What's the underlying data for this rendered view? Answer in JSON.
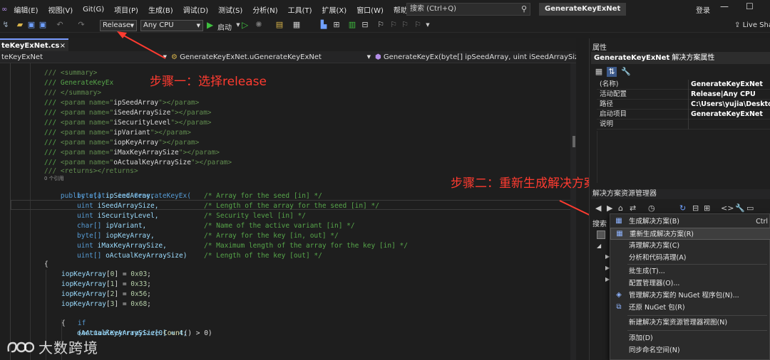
{
  "menubar": {
    "items": [
      "编辑(E)",
      "视图(V)",
      "Git(G)",
      "项目(P)",
      "生成(B)",
      "调试(D)",
      "测试(S)",
      "分析(N)",
      "工具(T)",
      "扩展(X)",
      "窗口(W)",
      "帮助(H)"
    ],
    "search_placeholder": "搜索 (Ctrl+Q)",
    "solution_name": "GenerateKeyExNet",
    "login": "登录"
  },
  "toolbar": {
    "configuration": "Release",
    "platform": "Any CPU",
    "start_label": "启动",
    "live_share": "Live Sha"
  },
  "doc_tab": {
    "label": "teKeyExNet.cs",
    "close": "×"
  },
  "navbar": {
    "project": "teKeyExNet",
    "class": "GenerateKeyExNet.uGenerateKeyExNet",
    "member": "GenerateKeyEx(byte[] ipSeedArray, uint iSeedArraySize"
  },
  "code": {
    "doc_summary_open": "/// <summary>",
    "doc_summary_text": "/// GenerateKeyEx",
    "doc_summary_close": "/// </summary>",
    "params": [
      "ipSeedArray",
      "iSeedArraySize",
      "iSecurityLevel",
      "ipVariant",
      "iopKeyArray",
      "iMaxKeyArraySize",
      "oActualKeyArraySize"
    ],
    "doc_returns": "/// <returns></returns>",
    "refs": "0 个引用",
    "signature": "public static int GenerateKeyEx(",
    "args": [
      {
        "type": "byte[]",
        "name": "ipSeedArray,",
        "comment": "/* Array for the seed [in] */"
      },
      {
        "type": "uint",
        "name": "iSeedArraySize,",
        "comment": "/* Length of the array for the seed [in] */"
      },
      {
        "type": "uint",
        "name": "iSecurityLevel,",
        "comment": "/* Security level [in] */"
      },
      {
        "type": "char[]",
        "name": "ipVariant,",
        "comment": "/* Name of the active variant [in] */"
      },
      {
        "type": "byte[]",
        "name": "iopKeyArray,",
        "comment": "/* Array for the key [in, out] */"
      },
      {
        "type": "uint",
        "name": "iMaxKeyArraySize,",
        "comment": "/* Maximum length of the array for the key [in] */"
      },
      {
        "type": "uint[]",
        "name": "oActualKeyArraySize)",
        "comment": "/* Length of the key [out] */"
      }
    ],
    "body": [
      {
        "idx": "0",
        "val": "0x03"
      },
      {
        "idx": "1",
        "val": "0x33"
      },
      {
        "idx": "2",
        "val": "0x56"
      },
      {
        "idx": "3",
        "val": "0x68"
      }
    ],
    "if_line_kw": "if",
    "if_line_cond": "(oActualKeyArraySize.",
    "if_line_fn": "Count",
    "if_line_rest": "() > 0)",
    "assign_line": "oActualKeyArraySize[0] = 4;"
  },
  "annotations": {
    "step1": "步骤一：选择release",
    "step2": "步骤二：重新生成解决方案"
  },
  "properties": {
    "title": "属性",
    "header_name": "GenerateKeyExNet",
    "header_suffix": "解决方案属性",
    "rows": [
      {
        "key": "(名称)",
        "value": "GenerateKeyExNet"
      },
      {
        "key": "活动配置",
        "value": "Release|Any CPU"
      },
      {
        "key": "路径",
        "value": "C:\\Users\\yujia\\Desktop\\"
      },
      {
        "key": "启动项目",
        "value": "GenerateKeyExNet"
      },
      {
        "key": "说明",
        "value": ""
      }
    ]
  },
  "solution_explorer": {
    "title": "解决方案资源管理器",
    "search": "搜索"
  },
  "context_menu": {
    "items": [
      {
        "label": "生成解决方案(B)",
        "shortcut": "Ctrl",
        "icon": "build-icon"
      },
      {
        "label": "重新生成解决方案(R)",
        "shortcut": "",
        "icon": "rebuild-icon"
      },
      {
        "label": "清理解决方案(C)",
        "shortcut": "",
        "icon": ""
      },
      {
        "label": "分析和代码清理(A)",
        "shortcut": "",
        "icon": ""
      },
      {
        "label": "批生成(T)...",
        "shortcut": "",
        "icon": ""
      },
      {
        "label": "配置管理器(O)...",
        "shortcut": "",
        "icon": ""
      },
      {
        "label": "管理解决方案的 NuGet 程序包(N)...",
        "shortcut": "",
        "icon": "nuget-icon"
      },
      {
        "label": "还原 NuGet 包(R)",
        "shortcut": "",
        "icon": "restore-icon"
      },
      {
        "label": "新建解决方案资源管理器视图(N)",
        "shortcut": "",
        "icon": ""
      },
      {
        "label": "添加(D)",
        "shortcut": "",
        "icon": ""
      },
      {
        "label": "同步命名空间(N)",
        "shortcut": "",
        "icon": ""
      }
    ]
  },
  "watermark": {
    "text": "大数跨境"
  }
}
